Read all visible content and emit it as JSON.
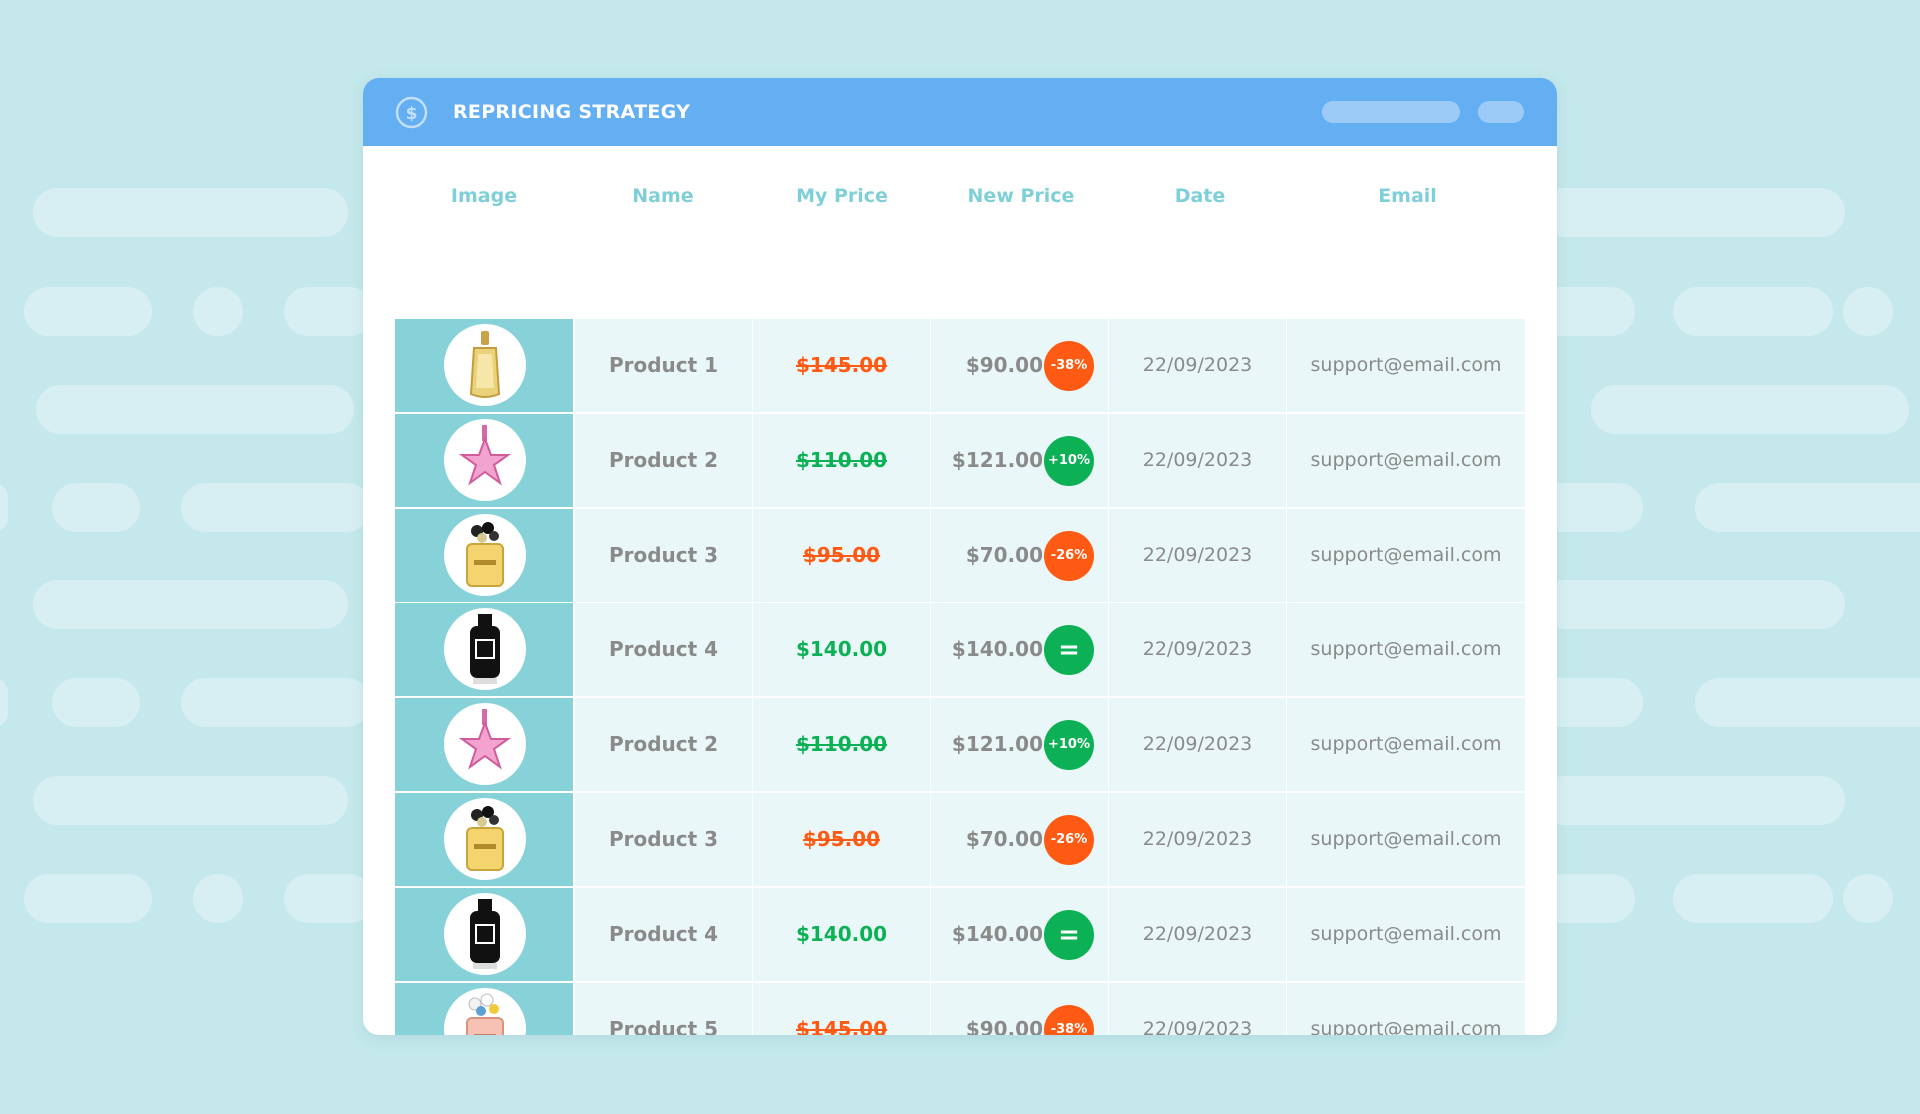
{
  "window": {
    "title": "REPRICING STRATEGY",
    "title_icon": "dollar-circle-icon"
  },
  "colors": {
    "background": "#c4e8eb",
    "titlebar": "#64aef2",
    "header_text": "#7fcfd8",
    "image_column": "#87d2d8",
    "row_cell": "#eaf7f8",
    "decrease": "#ff5a13",
    "increase": "#0db155"
  },
  "table": {
    "headers": [
      "Image",
      "Name",
      "My Price",
      "New Price",
      "Date",
      "Email"
    ],
    "rows": [
      {
        "image": "perfume-gold-bottle",
        "name": "Product 1",
        "my_price": "$145.00",
        "my_price_struck": true,
        "new_price": "$90.00",
        "change": "-38%",
        "direction": "down",
        "date": "22/09/2023",
        "email": "support@email.com"
      },
      {
        "image": "perfume-pink-star",
        "name": "Product 2",
        "my_price": "$110.00",
        "my_price_struck": true,
        "new_price": "$121.00",
        "change": "+10%",
        "direction": "up",
        "date": "22/09/2023",
        "email": "support@email.com"
      },
      {
        "image": "perfume-daisy-yellow",
        "name": "Product 3",
        "my_price": "$95.00",
        "my_price_struck": true,
        "new_price": "$70.00",
        "change": "-26%",
        "direction": "down",
        "date": "22/09/2023",
        "email": "support@email.com"
      },
      {
        "image": "perfume-black-bottle",
        "name": "Product 4",
        "my_price": "$140.00",
        "my_price_struck": false,
        "new_price": "$140.00",
        "change": "=",
        "direction": "same",
        "date": "22/09/2023",
        "email": "support@email.com"
      },
      {
        "image": "perfume-pink-star",
        "name": "Product 2",
        "my_price": "$110.00",
        "my_price_struck": true,
        "new_price": "$121.00",
        "change": "+10%",
        "direction": "up",
        "date": "22/09/2023",
        "email": "support@email.com"
      },
      {
        "image": "perfume-daisy-yellow",
        "name": "Product 3",
        "my_price": "$95.00",
        "my_price_struck": true,
        "new_price": "$70.00",
        "change": "-26%",
        "direction": "down",
        "date": "22/09/2023",
        "email": "support@email.com"
      },
      {
        "image": "perfume-black-bottle",
        "name": "Product 4",
        "my_price": "$140.00",
        "my_price_struck": false,
        "new_price": "$140.00",
        "change": "=",
        "direction": "same",
        "date": "22/09/2023",
        "email": "support@email.com"
      },
      {
        "image": "perfume-daisy-pink",
        "name": "Product 5",
        "my_price": "$145.00",
        "my_price_struck": true,
        "new_price": "$90.00",
        "change": "-38%",
        "direction": "down",
        "date": "22/09/2023",
        "email": "support@email.com"
      }
    ]
  }
}
